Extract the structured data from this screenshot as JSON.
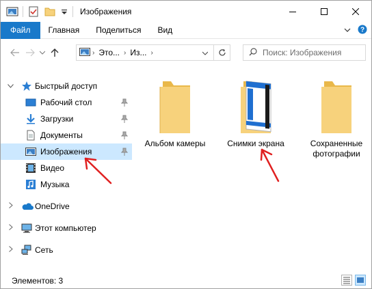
{
  "window": {
    "title": "Изображения"
  },
  "ribbon": {
    "tabs": [
      "Файл",
      "Главная",
      "Поделиться",
      "Вид"
    ]
  },
  "address": {
    "parts": [
      "Это...",
      "Из..."
    ],
    "search_placeholder": "Поиск: Изображения"
  },
  "nav": {
    "quick_access": "Быстрый доступ",
    "items": [
      "Рабочий стол",
      "Загрузки",
      "Документы",
      "Изображения",
      "Видео",
      "Музыка"
    ],
    "onedrive": "OneDrive",
    "this_pc": "Этот компьютер",
    "network": "Сеть"
  },
  "folders": [
    {
      "name": "Альбом камеры"
    },
    {
      "name": "Снимки экрана"
    },
    {
      "name_line1": "Сохраненные",
      "name_line2": "фотографии"
    }
  ],
  "status": {
    "items_count": "Элементов: 3"
  },
  "colors": {
    "accent": "#1979ca",
    "selection": "#cce8ff",
    "folder": "#f7d27c",
    "folder_dark": "#e9b84a",
    "annotation_arrow": "#e02020"
  }
}
